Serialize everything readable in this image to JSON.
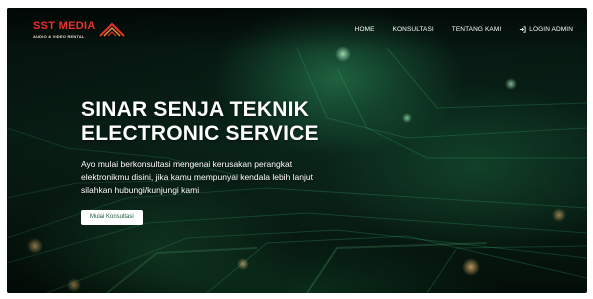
{
  "brand": {
    "name": "SST MEDIA",
    "tagline": "AUDIO & VIDEO RENTAL",
    "colors": {
      "red": "#e8312a",
      "orange": "#f08a24"
    }
  },
  "nav": {
    "items": [
      {
        "label": "HOME"
      },
      {
        "label": "KONSULTASI"
      },
      {
        "label": "TENTANG KAMI"
      },
      {
        "label": "LOGIN ADMIN",
        "icon": "login-icon"
      }
    ]
  },
  "hero": {
    "title_line1": "SINAR SENJA TEKNIK",
    "title_line2": "ELECTRONIC SERVICE",
    "description": "Ayo mulai berkonsultasi mengenai kerusakan perangkat elektronikmu disini, jika kamu mempunyai kendala lebih lanjut silahkan hubungi/kunjungi kami",
    "button_label": "Mulai Konsultasi",
    "background": "green circuit board"
  }
}
